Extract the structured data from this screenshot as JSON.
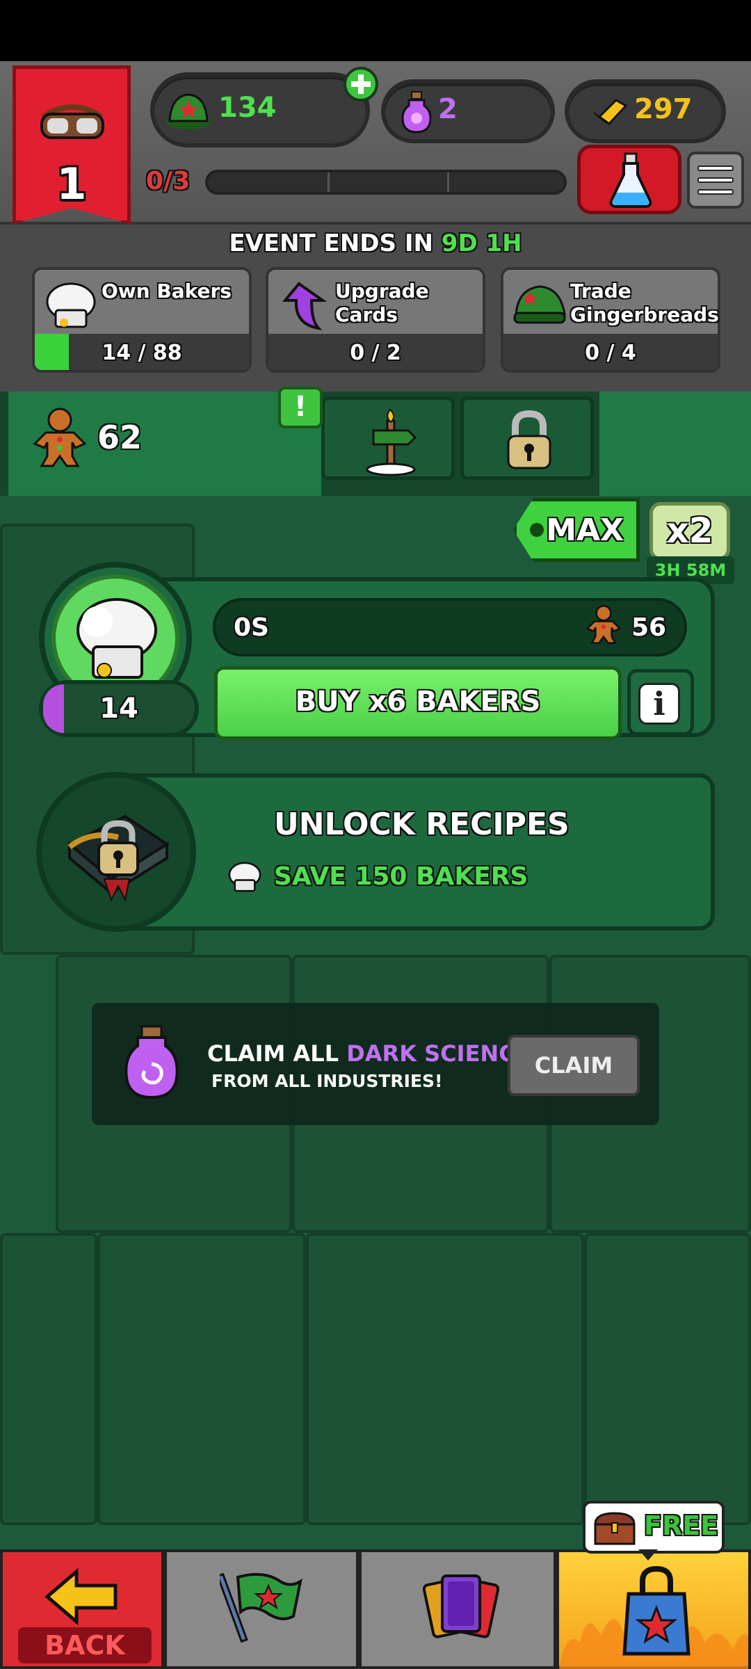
{
  "header": {
    "rank_level": "1",
    "currency_hats": "134",
    "currency_potions": "2",
    "currency_gold": "297",
    "progress_text": "0/3"
  },
  "event": {
    "ends_label": "EVENT ENDS IN",
    "ends_time": "9D 1H",
    "quests": [
      {
        "label": "Own Bakers",
        "count": "14 / 88",
        "progress": 0.16
      },
      {
        "label": "Upgrade Cards",
        "count": "0 / 2",
        "progress": 0
      },
      {
        "label": "Trade Gingerbreads",
        "count": "0 / 4",
        "progress": 0
      }
    ]
  },
  "tabs": {
    "gingerbread_count": "62",
    "alert": "!"
  },
  "multiplier": {
    "max_label": "MAX",
    "x2_label": "x2",
    "x2_timer": "3H 58M"
  },
  "baker": {
    "count": "14",
    "count_progress": 0.12,
    "timer": "0S",
    "reward": "56",
    "buy_label": "BUY x6 BAKERS",
    "info_label": "i"
  },
  "unlock": {
    "title": "UNLOCK RECIPES",
    "subtitle": "SAVE 150 BAKERS"
  },
  "claim": {
    "line1_prefix": "CLAIM ALL",
    "line1_highlight": "DARK SCIENCE",
    "line2": "FROM ALL INDUSTRIES!",
    "button_label": "CLAIM"
  },
  "bottom_nav": {
    "back_label": "BACK",
    "free_label": "FREE"
  },
  "colors": {
    "accent_green": "#4fe04f",
    "accent_purple": "#c070f0",
    "accent_red": "#e02a32",
    "accent_gold": "#f5c21a"
  }
}
